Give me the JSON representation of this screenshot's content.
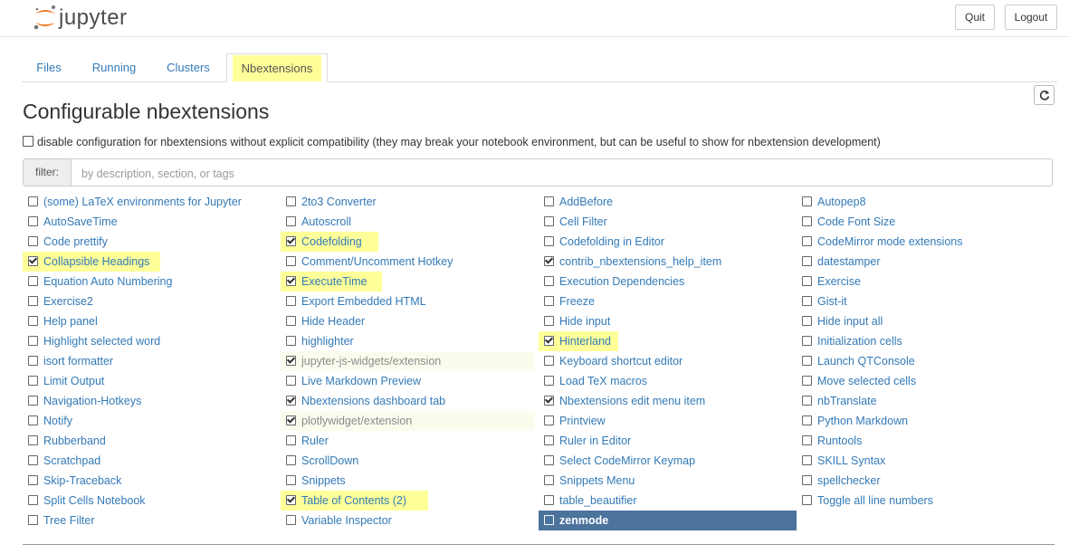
{
  "header": {
    "logo_text": "jupyter",
    "quit_label": "Quit",
    "logout_label": "Logout"
  },
  "tabs": [
    "Files",
    "Running",
    "Clusters",
    "Nbextensions"
  ],
  "active_tab": "Nbextensions",
  "page_title": "Configurable nbextensions",
  "disable_config_label": "disable configuration for nbextensions without explicit compatibility (they may break your notebook environment, but can be useful to show for nbextension development)",
  "filter": {
    "label": "filter:",
    "placeholder": "by description, section, or tags"
  },
  "colors": {
    "highlight": "#ffff99",
    "link": "#337ab7",
    "selected_bg": "#4b739c"
  },
  "extensions": [
    [
      {
        "name": "(some) LaTeX environments for Jupyter",
        "checked": false
      },
      {
        "name": "AutoSaveTime",
        "checked": false
      },
      {
        "name": "Code prettify",
        "checked": false
      },
      {
        "name": "Collapsible Headings",
        "checked": true,
        "highlight": true
      },
      {
        "name": "Equation Auto Numbering",
        "checked": false
      },
      {
        "name": "Exercise2",
        "checked": false
      },
      {
        "name": "Help panel",
        "checked": false
      },
      {
        "name": "Highlight selected word",
        "checked": false
      },
      {
        "name": "isort formatter",
        "checked": false
      },
      {
        "name": "Limit Output",
        "checked": false
      },
      {
        "name": "Navigation-Hotkeys",
        "checked": false
      },
      {
        "name": "Notify",
        "checked": false
      },
      {
        "name": "Rubberband",
        "checked": false
      },
      {
        "name": "Scratchpad",
        "checked": false
      },
      {
        "name": "Skip-Traceback",
        "checked": false
      },
      {
        "name": "Split Cells Notebook",
        "checked": false
      },
      {
        "name": "Tree Filter",
        "checked": false
      }
    ],
    [
      {
        "name": "2to3 Converter",
        "checked": false
      },
      {
        "name": "Autoscroll",
        "checked": false
      },
      {
        "name": "Codefolding",
        "checked": true,
        "highlight": true
      },
      {
        "name": "Comment/Uncomment Hotkey",
        "checked": false
      },
      {
        "name": "ExecuteTime",
        "checked": true,
        "highlight": true
      },
      {
        "name": "Export Embedded HTML",
        "checked": false
      },
      {
        "name": "Hide Header",
        "checked": false
      },
      {
        "name": "highlighter",
        "checked": false
      },
      {
        "name": "jupyter-js-widgets/extension",
        "checked": true,
        "unconfigurable": true
      },
      {
        "name": "Live Markdown Preview",
        "checked": false
      },
      {
        "name": "Nbextensions dashboard tab",
        "checked": true
      },
      {
        "name": "plotlywidget/extension",
        "checked": true,
        "unconfigurable": true
      },
      {
        "name": "Ruler",
        "checked": false
      },
      {
        "name": "ScrollDown",
        "checked": false
      },
      {
        "name": "Snippets",
        "checked": false
      },
      {
        "name": "Table of Contents (2)",
        "checked": true,
        "highlight": true
      },
      {
        "name": "Variable Inspector",
        "checked": false
      }
    ],
    [
      {
        "name": "AddBefore",
        "checked": false
      },
      {
        "name": "Cell Filter",
        "checked": false
      },
      {
        "name": "Codefolding in Editor",
        "checked": false
      },
      {
        "name": "contrib_nbextensions_help_item",
        "checked": true
      },
      {
        "name": "Execution Dependencies",
        "checked": false
      },
      {
        "name": "Freeze",
        "checked": false
      },
      {
        "name": "Hide input",
        "checked": false
      },
      {
        "name": "Hinterland",
        "checked": true,
        "highlight": true
      },
      {
        "name": "Keyboard shortcut editor",
        "checked": false
      },
      {
        "name": "Load TeX macros",
        "checked": false
      },
      {
        "name": "Nbextensions edit menu item",
        "checked": true
      },
      {
        "name": "Printview",
        "checked": false
      },
      {
        "name": "Ruler in Editor",
        "checked": false
      },
      {
        "name": "Select CodeMirror Keymap",
        "checked": false
      },
      {
        "name": "Snippets Menu",
        "checked": false
      },
      {
        "name": "table_beautifier",
        "checked": false
      },
      {
        "name": "zenmode",
        "checked": false,
        "selected": true
      }
    ],
    [
      {
        "name": "Autopep8",
        "checked": false
      },
      {
        "name": "Code Font Size",
        "checked": false
      },
      {
        "name": "CodeMirror mode extensions",
        "checked": false
      },
      {
        "name": "datestamper",
        "checked": false
      },
      {
        "name": "Exercise",
        "checked": false
      },
      {
        "name": "Gist-it",
        "checked": false
      },
      {
        "name": "Hide input all",
        "checked": false
      },
      {
        "name": "Initialization cells",
        "checked": false
      },
      {
        "name": "Launch QTConsole",
        "checked": false
      },
      {
        "name": "Move selected cells",
        "checked": false
      },
      {
        "name": "nbTranslate",
        "checked": false
      },
      {
        "name": "Python Markdown",
        "checked": false
      },
      {
        "name": "Runtools",
        "checked": false
      },
      {
        "name": "SKILL Syntax",
        "checked": false
      },
      {
        "name": "spellchecker",
        "checked": false
      },
      {
        "name": "Toggle all line numbers",
        "checked": false
      }
    ]
  ]
}
